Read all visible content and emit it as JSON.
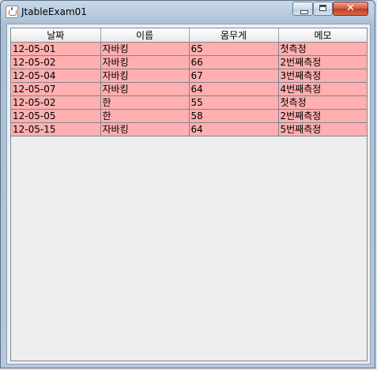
{
  "window": {
    "title": "JtableExam01"
  },
  "table": {
    "columns": [
      "날짜",
      "이름",
      "몸무게",
      "메모"
    ],
    "rows": [
      [
        "12-05-01",
        "자바킹",
        "65",
        "첫측정"
      ],
      [
        "12-05-02",
        "자바킹",
        "66",
        "2번째측정"
      ],
      [
        "12-05-04",
        "자바킹",
        "67",
        "3번째측정"
      ],
      [
        "12-05-07",
        "자바킹",
        "64",
        "4번째측정"
      ],
      [
        "12-05-02",
        "한",
        "55",
        "첫측정"
      ],
      [
        "12-05-05",
        "한",
        "58",
        "2번째측정"
      ],
      [
        "12-05-15",
        "자바킹",
        "64",
        "5번째측정"
      ]
    ]
  },
  "colors": {
    "row_background": "#ffafaf",
    "panel_background": "#f0f0f0"
  }
}
